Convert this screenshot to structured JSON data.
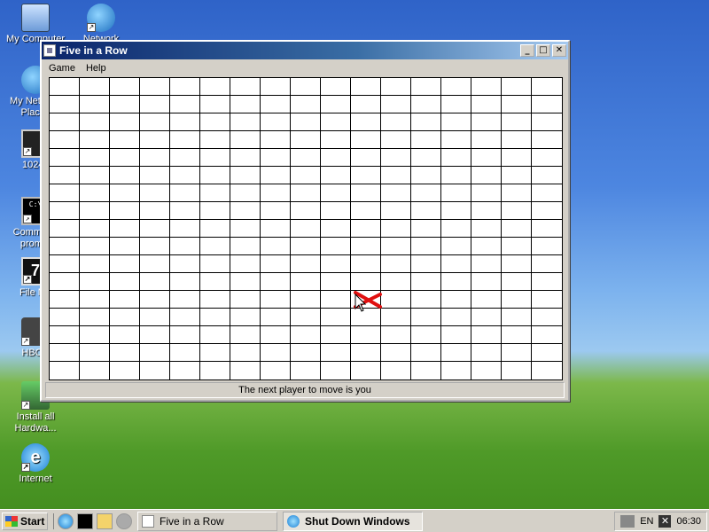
{
  "desktop": {
    "icons": [
      {
        "label": "My Computer",
        "icon": "computer-icon"
      },
      {
        "label": "Network Setup",
        "icon": "network-setup-icon"
      },
      {
        "label": "My Network Places",
        "icon": "network-places-icon"
      },
      {
        "label": "1024x",
        "icon": "display-icon"
      },
      {
        "label": "Command prompt",
        "icon": "cmd-icon"
      },
      {
        "label": "File Ma",
        "icon": "file-manager-icon"
      },
      {
        "label": "HBCD",
        "icon": "hbcd-icon"
      },
      {
        "label": "Install all Hardwa...",
        "icon": "install-icon"
      },
      {
        "label": "Internet",
        "icon": "internet-explorer-icon"
      }
    ]
  },
  "window": {
    "title": "Five in a Row",
    "buttons": {
      "minimize": "_",
      "maximize": "□",
      "close": "✕"
    },
    "menu": [
      "Game",
      "Help"
    ],
    "board": {
      "columns": 17,
      "rows": 17
    },
    "status": "The next player to move is you",
    "cursor_mark_color": "#e01010"
  },
  "taskbar": {
    "start_label": "Start",
    "quick_launch": [
      "internet-explorer-icon",
      "cmd-icon",
      "folder-icon",
      "drive-icon"
    ],
    "tasks": [
      {
        "label": "Five in a Row",
        "pressed": false
      },
      {
        "label": "Shut Down Windows",
        "pressed": true
      }
    ],
    "tray": {
      "language": "EN",
      "clock": "06:30"
    }
  }
}
